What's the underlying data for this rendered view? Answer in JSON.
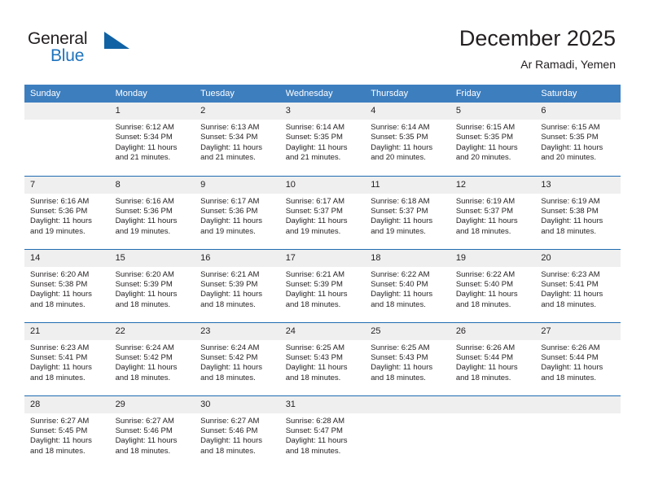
{
  "brand": {
    "name_top": "General",
    "name_bottom": "Blue",
    "accent_color": "#1062a4",
    "text_color": "#231f20"
  },
  "header": {
    "title": "December 2025",
    "subtitle": "Ar Ramadi, Yemen"
  },
  "theme": {
    "header_row_bg": "#3d7ebf",
    "row_divider": "#1f6cb0",
    "daynum_band_bg": "#efefef",
    "cell_bg": "#ffffff",
    "text": "#231f20"
  },
  "weekdays": [
    "Sunday",
    "Monday",
    "Tuesday",
    "Wednesday",
    "Thursday",
    "Friday",
    "Saturday"
  ],
  "weeks": [
    [
      {
        "day": "",
        "lines": []
      },
      {
        "day": "1",
        "lines": [
          "Sunrise: 6:12 AM",
          "Sunset: 5:34 PM",
          "Daylight: 11 hours",
          "and 21 minutes."
        ]
      },
      {
        "day": "2",
        "lines": [
          "Sunrise: 6:13 AM",
          "Sunset: 5:34 PM",
          "Daylight: 11 hours",
          "and 21 minutes."
        ]
      },
      {
        "day": "3",
        "lines": [
          "Sunrise: 6:14 AM",
          "Sunset: 5:35 PM",
          "Daylight: 11 hours",
          "and 21 minutes."
        ]
      },
      {
        "day": "4",
        "lines": [
          "Sunrise: 6:14 AM",
          "Sunset: 5:35 PM",
          "Daylight: 11 hours",
          "and 20 minutes."
        ]
      },
      {
        "day": "5",
        "lines": [
          "Sunrise: 6:15 AM",
          "Sunset: 5:35 PM",
          "Daylight: 11 hours",
          "and 20 minutes."
        ]
      },
      {
        "day": "6",
        "lines": [
          "Sunrise: 6:15 AM",
          "Sunset: 5:35 PM",
          "Daylight: 11 hours",
          "and 20 minutes."
        ]
      }
    ],
    [
      {
        "day": "7",
        "lines": [
          "Sunrise: 6:16 AM",
          "Sunset: 5:36 PM",
          "Daylight: 11 hours",
          "and 19 minutes."
        ]
      },
      {
        "day": "8",
        "lines": [
          "Sunrise: 6:16 AM",
          "Sunset: 5:36 PM",
          "Daylight: 11 hours",
          "and 19 minutes."
        ]
      },
      {
        "day": "9",
        "lines": [
          "Sunrise: 6:17 AM",
          "Sunset: 5:36 PM",
          "Daylight: 11 hours",
          "and 19 minutes."
        ]
      },
      {
        "day": "10",
        "lines": [
          "Sunrise: 6:17 AM",
          "Sunset: 5:37 PM",
          "Daylight: 11 hours",
          "and 19 minutes."
        ]
      },
      {
        "day": "11",
        "lines": [
          "Sunrise: 6:18 AM",
          "Sunset: 5:37 PM",
          "Daylight: 11 hours",
          "and 19 minutes."
        ]
      },
      {
        "day": "12",
        "lines": [
          "Sunrise: 6:19 AM",
          "Sunset: 5:37 PM",
          "Daylight: 11 hours",
          "and 18 minutes."
        ]
      },
      {
        "day": "13",
        "lines": [
          "Sunrise: 6:19 AM",
          "Sunset: 5:38 PM",
          "Daylight: 11 hours",
          "and 18 minutes."
        ]
      }
    ],
    [
      {
        "day": "14",
        "lines": [
          "Sunrise: 6:20 AM",
          "Sunset: 5:38 PM",
          "Daylight: 11 hours",
          "and 18 minutes."
        ]
      },
      {
        "day": "15",
        "lines": [
          "Sunrise: 6:20 AM",
          "Sunset: 5:39 PM",
          "Daylight: 11 hours",
          "and 18 minutes."
        ]
      },
      {
        "day": "16",
        "lines": [
          "Sunrise: 6:21 AM",
          "Sunset: 5:39 PM",
          "Daylight: 11 hours",
          "and 18 minutes."
        ]
      },
      {
        "day": "17",
        "lines": [
          "Sunrise: 6:21 AM",
          "Sunset: 5:39 PM",
          "Daylight: 11 hours",
          "and 18 minutes."
        ]
      },
      {
        "day": "18",
        "lines": [
          "Sunrise: 6:22 AM",
          "Sunset: 5:40 PM",
          "Daylight: 11 hours",
          "and 18 minutes."
        ]
      },
      {
        "day": "19",
        "lines": [
          "Sunrise: 6:22 AM",
          "Sunset: 5:40 PM",
          "Daylight: 11 hours",
          "and 18 minutes."
        ]
      },
      {
        "day": "20",
        "lines": [
          "Sunrise: 6:23 AM",
          "Sunset: 5:41 PM",
          "Daylight: 11 hours",
          "and 18 minutes."
        ]
      }
    ],
    [
      {
        "day": "21",
        "lines": [
          "Sunrise: 6:23 AM",
          "Sunset: 5:41 PM",
          "Daylight: 11 hours",
          "and 18 minutes."
        ]
      },
      {
        "day": "22",
        "lines": [
          "Sunrise: 6:24 AM",
          "Sunset: 5:42 PM",
          "Daylight: 11 hours",
          "and 18 minutes."
        ]
      },
      {
        "day": "23",
        "lines": [
          "Sunrise: 6:24 AM",
          "Sunset: 5:42 PM",
          "Daylight: 11 hours",
          "and 18 minutes."
        ]
      },
      {
        "day": "24",
        "lines": [
          "Sunrise: 6:25 AM",
          "Sunset: 5:43 PM",
          "Daylight: 11 hours",
          "and 18 minutes."
        ]
      },
      {
        "day": "25",
        "lines": [
          "Sunrise: 6:25 AM",
          "Sunset: 5:43 PM",
          "Daylight: 11 hours",
          "and 18 minutes."
        ]
      },
      {
        "day": "26",
        "lines": [
          "Sunrise: 6:26 AM",
          "Sunset: 5:44 PM",
          "Daylight: 11 hours",
          "and 18 minutes."
        ]
      },
      {
        "day": "27",
        "lines": [
          "Sunrise: 6:26 AM",
          "Sunset: 5:44 PM",
          "Daylight: 11 hours",
          "and 18 minutes."
        ]
      }
    ],
    [
      {
        "day": "28",
        "lines": [
          "Sunrise: 6:27 AM",
          "Sunset: 5:45 PM",
          "Daylight: 11 hours",
          "and 18 minutes."
        ]
      },
      {
        "day": "29",
        "lines": [
          "Sunrise: 6:27 AM",
          "Sunset: 5:46 PM",
          "Daylight: 11 hours",
          "and 18 minutes."
        ]
      },
      {
        "day": "30",
        "lines": [
          "Sunrise: 6:27 AM",
          "Sunset: 5:46 PM",
          "Daylight: 11 hours",
          "and 18 minutes."
        ]
      },
      {
        "day": "31",
        "lines": [
          "Sunrise: 6:28 AM",
          "Sunset: 5:47 PM",
          "Daylight: 11 hours",
          "and 18 minutes."
        ]
      },
      {
        "day": "",
        "lines": []
      },
      {
        "day": "",
        "lines": []
      },
      {
        "day": "",
        "lines": []
      }
    ]
  ]
}
